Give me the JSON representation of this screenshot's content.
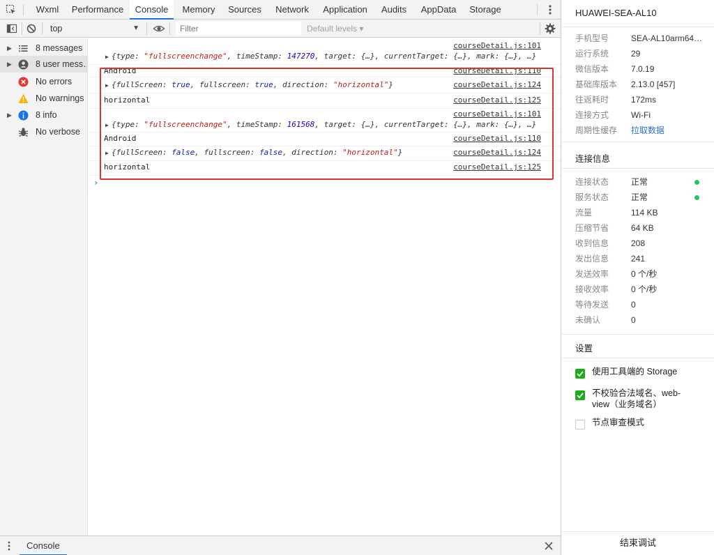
{
  "tabs": [
    "Wxml",
    "Performance",
    "Console",
    "Memory",
    "Sources",
    "Network",
    "Application",
    "Audits",
    "AppData",
    "Storage"
  ],
  "active_tab": "Console",
  "toolbar": {
    "context": "top",
    "filter_placeholder": "Filter",
    "levels": "Default levels"
  },
  "sidebar": {
    "items": [
      {
        "label": "8 messages",
        "icon": "list-icon"
      },
      {
        "label": "8 user mess…",
        "icon": "user-icon"
      },
      {
        "label": "No errors",
        "icon": "error-icon"
      },
      {
        "label": "No warnings",
        "icon": "warning-icon"
      },
      {
        "label": "8 info",
        "icon": "info-icon"
      },
      {
        "label": "No verbose",
        "icon": "bug-icon"
      }
    ]
  },
  "console": {
    "rows": [
      {
        "source": "courseDetail.js:101",
        "tokens": [
          [
            "k",
            "{type: "
          ],
          [
            "s",
            "\"fullscreenchange\""
          ],
          [
            "k",
            ", timeStamp: "
          ],
          [
            "n",
            "147270"
          ],
          [
            "k",
            ", target: {…}, currentTarget: {…}, mark: {…}, …}"
          ]
        ]
      },
      {
        "text": "Android",
        "source": "courseDetail.js:110"
      },
      {
        "source": "courseDetail.js:124",
        "tokens": [
          [
            "k",
            "{fullScreen: "
          ],
          [
            "b",
            "true"
          ],
          [
            "k",
            ", fullscreen: "
          ],
          [
            "b",
            "true"
          ],
          [
            "k",
            ", direction: "
          ],
          [
            "s",
            "\"horizontal\""
          ],
          [
            "k",
            "}"
          ]
        ]
      },
      {
        "text": "horizontal",
        "source": "courseDetail.js:125"
      },
      {
        "source": "courseDetail.js:101",
        "tokens": [
          [
            "k",
            "{type: "
          ],
          [
            "s",
            "\"fullscreenchange\""
          ],
          [
            "k",
            ", timeStamp: "
          ],
          [
            "n",
            "161568"
          ],
          [
            "k",
            ", target: {…}, currentTarget: {…}, mark: {…}, …}"
          ]
        ]
      },
      {
        "text": "Android",
        "source": "courseDetail.js:110"
      },
      {
        "source": "courseDetail.js:124",
        "tokens": [
          [
            "k",
            "{fullScreen: "
          ],
          [
            "b",
            "false"
          ],
          [
            "k",
            ", fullscreen: "
          ],
          [
            "b",
            "false"
          ],
          [
            "k",
            ", direction: "
          ],
          [
            "s",
            "\"horizontal\""
          ],
          [
            "k",
            "}"
          ]
        ]
      },
      {
        "text": "horizontal",
        "source": "courseDetail.js:125"
      }
    ],
    "prompt": "›"
  },
  "drawer": {
    "tab": "Console"
  },
  "panel": {
    "device": "HUAWEI-SEA-AL10",
    "info": [
      {
        "k": "手机型号",
        "v": "SEA-AL10arm64-…"
      },
      {
        "k": "运行系统",
        "v": "29"
      },
      {
        "k": "微信版本",
        "v": "7.0.19"
      },
      {
        "k": "基础库版本",
        "v": "2.13.0 [457]"
      },
      {
        "k": "往返耗时",
        "v": "172ms"
      },
      {
        "k": "连接方式",
        "v": "Wi-Fi"
      },
      {
        "k": "周期性缓存",
        "v": "拉取数据"
      }
    ],
    "conn_title": "连接信息",
    "conn": [
      {
        "k": "连接状态",
        "v": "正常"
      },
      {
        "k": "服务状态",
        "v": "正常"
      },
      {
        "k": "流量",
        "v": "114 KB"
      },
      {
        "k": "压缩节省",
        "v": "64 KB"
      },
      {
        "k": "收到信息",
        "v": "208"
      },
      {
        "k": "发出信息",
        "v": "241"
      },
      {
        "k": "发送效率",
        "v": "0 个/秒"
      },
      {
        "k": "接收效率",
        "v": "0 个/秒"
      },
      {
        "k": "等待发送",
        "v": "0"
      },
      {
        "k": "未确认",
        "v": "0"
      }
    ],
    "settings_title": "设置",
    "settings": [
      {
        "label": "使用工具端的 Storage",
        "checked": true
      },
      {
        "label": "不校验合法域名、web-view（业务域名）",
        "checked": true
      },
      {
        "label": "节点审查模式",
        "checked": false
      }
    ],
    "end_button": "结束调试",
    "status_color": "#22c55e",
    "accent_color": "#1a73e8"
  }
}
